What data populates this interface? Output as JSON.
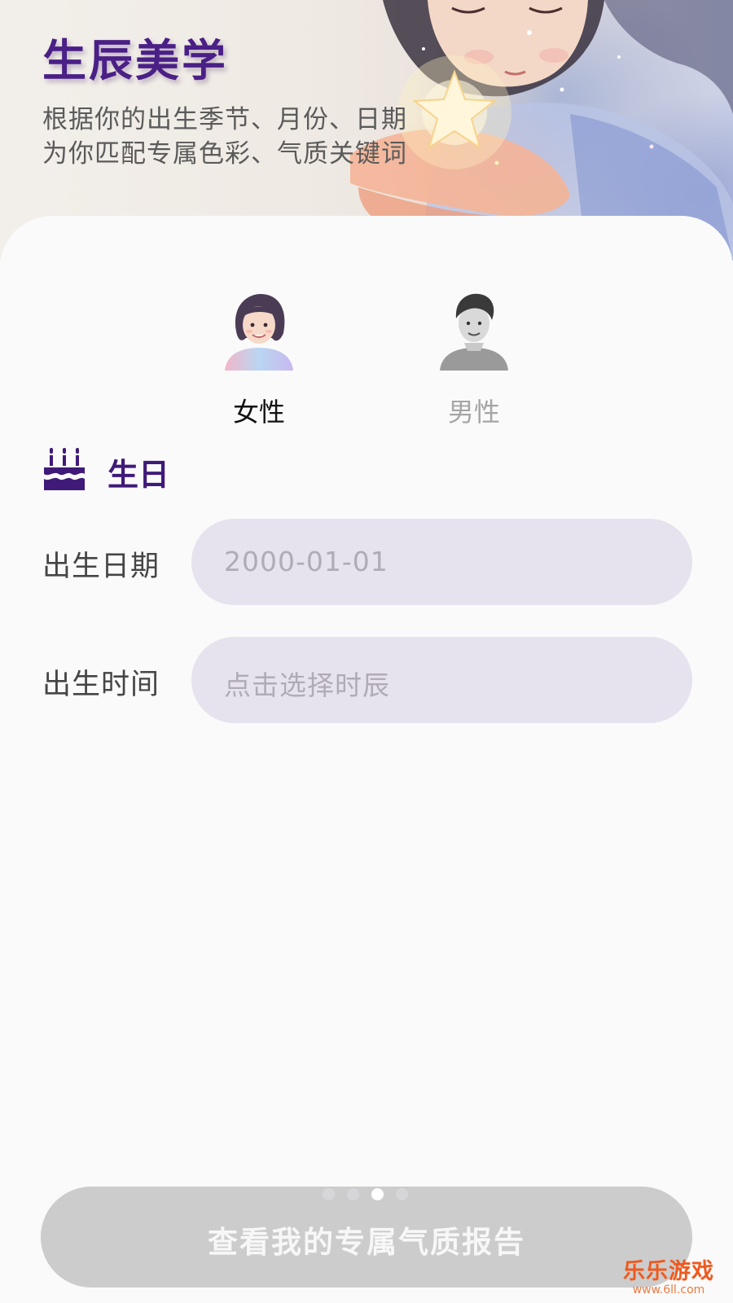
{
  "header": {
    "title": "生辰美学",
    "subtitle_line1": "根据你的出生季节、月份、日期",
    "subtitle_line2": "为你匹配专属色彩、气质关键词"
  },
  "gender": {
    "options": [
      {
        "label": "女性",
        "selected": true,
        "icon": "female-avatar"
      },
      {
        "label": "男性",
        "selected": false,
        "icon": "male-avatar"
      }
    ]
  },
  "birthday_section": {
    "icon": "cake-icon",
    "title": "生日",
    "date_label": "出生日期",
    "date_placeholder": "2000-01-01",
    "time_label": "出生时间",
    "time_placeholder": "点击选择时辰"
  },
  "pager": {
    "count": 4,
    "active_index": 2
  },
  "submit": {
    "label": "查看我的专属气质报告"
  },
  "watermark": {
    "main": "乐乐游戏",
    "sub": "www.6ll.com"
  },
  "colors": {
    "brand_purple": "#4a1f86",
    "input_bg": "#e6e2ee",
    "button_disabled": "#cccccc",
    "watermark": "#ef5a1f"
  }
}
